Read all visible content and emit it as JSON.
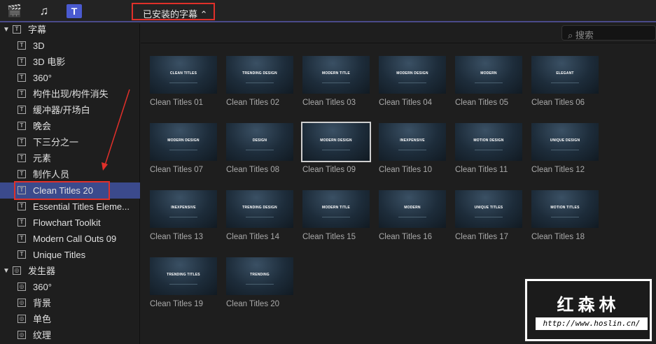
{
  "toolbar": {
    "icons": [
      "clapper-star-icon",
      "music-photo-icon",
      "titles-icon"
    ],
    "selector": "已安装的字幕 ⌃"
  },
  "search": {
    "placeholder": "搜索"
  },
  "sidebar": {
    "titles_header": "字幕",
    "titles": [
      "3D",
      "3D 电影",
      "360°",
      "构件出现/构件消失",
      "缓冲器/开场白",
      "晚会",
      "下三分之一",
      "元素",
      "制作人员",
      "Clean Titles 20",
      "Essential Titles Eleme...",
      "Flowchart Toolkit",
      "Modern Call Outs 09",
      "Unique Titles"
    ],
    "selected_index": 9,
    "generators_header": "发生器",
    "generators": [
      "360°",
      "背景",
      "单色",
      "纹理"
    ]
  },
  "grid": {
    "selected_index": 8,
    "items": [
      {
        "label": "Clean Titles 01",
        "thumb": "CLEAN TITLES"
      },
      {
        "label": "Clean Titles 02",
        "thumb": "TRENDING DESIGN"
      },
      {
        "label": "Clean Titles 03",
        "thumb": "MODERN TITLE"
      },
      {
        "label": "Clean Titles 04",
        "thumb": "MODERN DESIGN"
      },
      {
        "label": "Clean Titles 05",
        "thumb": "MODERN"
      },
      {
        "label": "Clean Titles 06",
        "thumb": "ELEGANT"
      },
      {
        "label": "Clean Titles 07",
        "thumb": "MODERN DESIGN"
      },
      {
        "label": "Clean Titles 08",
        "thumb": "DESIGN"
      },
      {
        "label": "Clean Titles 09",
        "thumb": "MODERN DESIGN"
      },
      {
        "label": "Clean Titles 10",
        "thumb": "INEXPENSIVE"
      },
      {
        "label": "Clean Titles 11",
        "thumb": "MOTION DESIGN"
      },
      {
        "label": "Clean Titles 12",
        "thumb": "UNIQUE DESIGN"
      },
      {
        "label": "Clean Titles 13",
        "thumb": "INEXPENSIVE"
      },
      {
        "label": "Clean Titles 14",
        "thumb": "TRENDING DESIGN"
      },
      {
        "label": "Clean Titles 15",
        "thumb": "MODERN TITLE"
      },
      {
        "label": "Clean Titles 16",
        "thumb": "MODERN"
      },
      {
        "label": "Clean Titles 17",
        "thumb": "UNIQUE TITLES"
      },
      {
        "label": "Clean Titles 18",
        "thumb": "MOTION TITLES"
      },
      {
        "label": "Clean Titles 19",
        "thumb": "TRENDING TITLES"
      },
      {
        "label": "Clean Titles 20",
        "thumb": "TRENDING"
      }
    ]
  },
  "watermark": {
    "title": "红森林",
    "url": "http://www.hoslin.cn/"
  },
  "colors": {
    "accent": "#3b4a8c",
    "annotation": "#e0302a"
  }
}
